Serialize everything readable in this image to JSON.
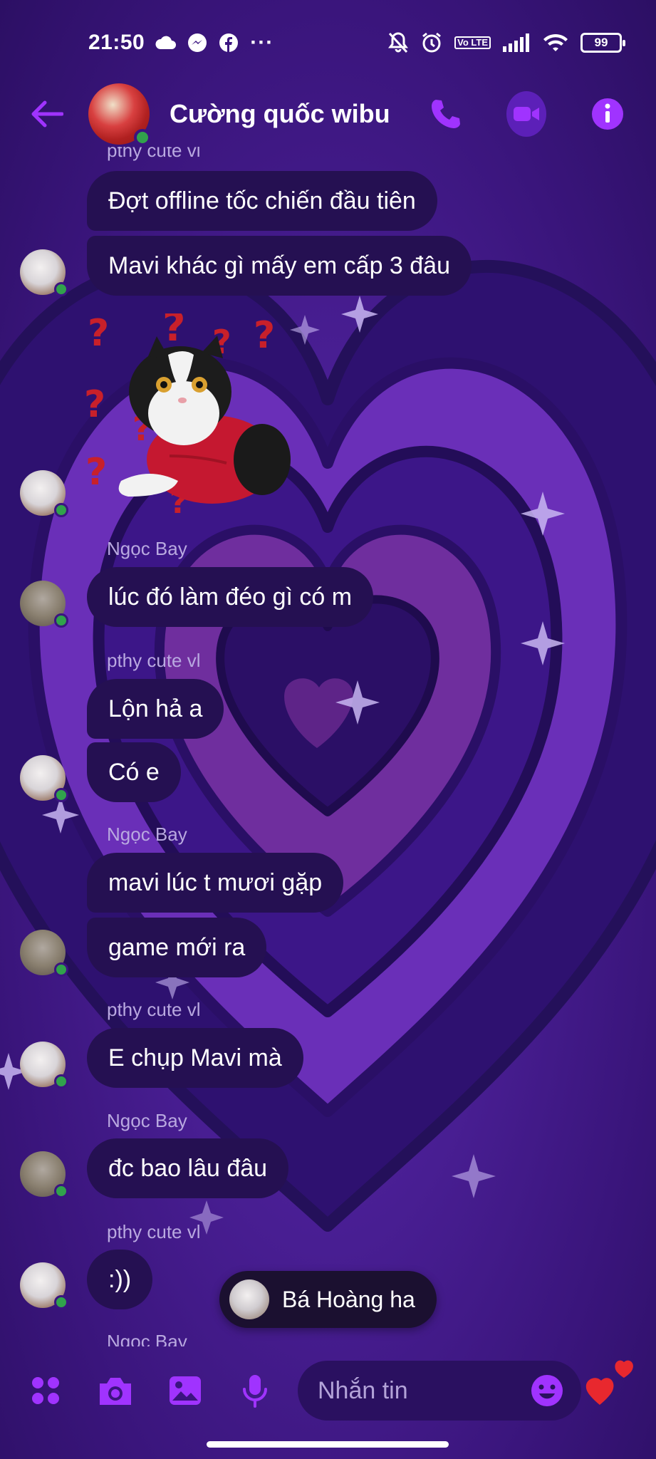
{
  "status_bar": {
    "time": "21:50",
    "volte": "Vo LTE",
    "battery": "99",
    "more": "···"
  },
  "header": {
    "title": "Cường quốc wibu"
  },
  "messages": [
    {
      "sender": "pthy cute vl",
      "text": "Đợt offline tốc chiến đầu tiên"
    },
    {
      "text": "Mavi khác gì mấy em cấp 3 đâu"
    },
    {
      "sender": "Ngọc Bay",
      "text": "lúc đó làm đéo gì có m"
    },
    {
      "sender": "pthy cute vl",
      "text": "Lộn hả a"
    },
    {
      "text": "Có e"
    },
    {
      "sender": "Ngọc Bay",
      "text": "mavi lúc t mươi gặp"
    },
    {
      "text": "game mới ra"
    },
    {
      "sender": "pthy cute vl",
      "text": "E chụp Mavi mà"
    },
    {
      "sender": "Ngọc Bay",
      "text": "đc bao lâu đâu"
    },
    {
      "sender": "pthy cute vl",
      "text": ":))"
    },
    {
      "sender": "Ngọc Bay"
    }
  ],
  "typing_pill": {
    "text": "Bá Hoàng ha"
  },
  "composer": {
    "placeholder": "Nhắn tin"
  },
  "colors": {
    "accent": "#a033ff",
    "bubble": "#251052",
    "online": "#31a24c",
    "like": "#e8282e"
  },
  "icons": [
    "back-arrow-icon",
    "phone-icon",
    "video-icon",
    "info-icon",
    "apps-icon",
    "camera-icon",
    "image-icon",
    "mic-icon",
    "emoji-icon",
    "heart-icon"
  ]
}
